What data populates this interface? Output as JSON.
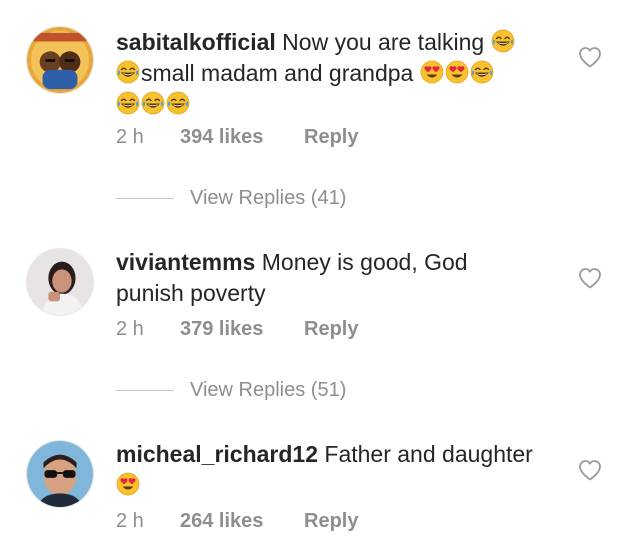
{
  "comments": [
    {
      "username": "sabitalkofficial",
      "text_a": "Now you are talking",
      "text_b": "small madam and grandpa",
      "time": "2 h",
      "likes": "394 likes",
      "reply_label": "Reply",
      "avatar": "cartoon-avatar",
      "view_replies": "View Replies (41)"
    },
    {
      "username": "viviantemms",
      "text_a": "Money is good, God punish poverty",
      "time": "2 h",
      "likes": "379 likes",
      "reply_label": "Reply",
      "avatar": "photo-avatar-woman",
      "view_replies": "View Replies (51)"
    },
    {
      "username": "micheal_richard12",
      "text_a": "Father and daughter",
      "time": "2 h",
      "likes": "264 likes",
      "reply_label": "Reply",
      "avatar": "photo-avatar-man-sunglasses"
    }
  ],
  "icons": {
    "like": "heart-outline-icon",
    "laugh": "tears-of-joy-emoji",
    "love": "heart-eyes-emoji"
  },
  "colors": {
    "text": "#262626",
    "meta": "#8e8e8e",
    "emoji_yellow": "#f8c12e",
    "emoji_heart": "#e8213f"
  }
}
